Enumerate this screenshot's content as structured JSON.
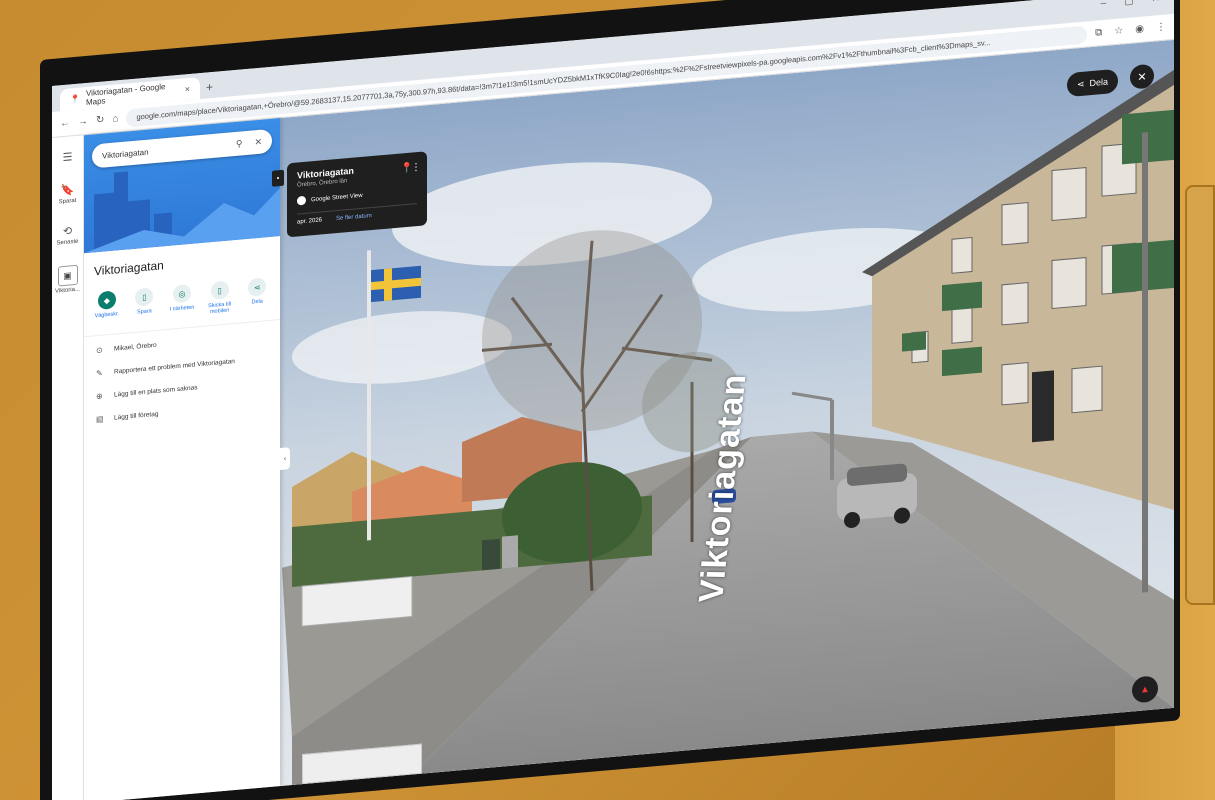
{
  "browser": {
    "tab_title": "Viktoriagatan - Google Maps",
    "url": "google.com/maps/place/Viktoriagatan,+Örebro/@59.2683137,15.2077701,3a,75y,300.97h,93.86t/data=!3m7!1e1!3m5!1smUcYDZ5bkM1xTfK9C0Iag!2e0!6shttps:%2F%2Fstreetviewpixels-pa.googleapis.com%2Fv1%2Fthumbnail%3Fcb_client%3Dmaps_sv..."
  },
  "rail": {
    "items": [
      {
        "label": "",
        "icon": "menu-icon"
      },
      {
        "label": "Sparat",
        "icon": "bookmark-icon"
      },
      {
        "label": "Senaste",
        "icon": "history-icon"
      },
      {
        "label": "Viktoria...",
        "icon": "place-thumb-icon"
      }
    ]
  },
  "panel": {
    "search_value": "Viktoriagatan",
    "place_title": "Viktoriagatan",
    "actions": [
      {
        "label": "Vägbeskr.",
        "icon": "directions-icon"
      },
      {
        "label": "Spara",
        "icon": "bookmark-icon"
      },
      {
        "label": "I närheten",
        "icon": "nearby-icon"
      },
      {
        "label": "Skicka till mobilen",
        "icon": "send-phone-icon"
      },
      {
        "label": "Dela",
        "icon": "share-icon"
      }
    ],
    "info": [
      {
        "text": "Mikael, Örebro",
        "icon": "pin-icon"
      },
      {
        "text": "Rapportera ett problem med Viktoriagatan",
        "icon": "pencil-icon"
      },
      {
        "text": "Lägg till en plats som saknas",
        "icon": "add-place-icon"
      },
      {
        "text": "Lägg till företag",
        "icon": "business-icon"
      }
    ]
  },
  "card": {
    "title": "Viktoriagatan",
    "subtitle": "Örebro, Örebro län",
    "sv_label": "Google Street View",
    "date": "apr. 2026",
    "more_dates": "Se fler datum"
  },
  "overlay": {
    "share_label": "Dela",
    "street_name": "Viktoriagatan"
  }
}
